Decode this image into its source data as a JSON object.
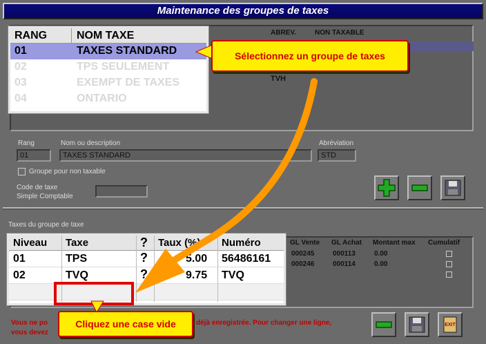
{
  "window": {
    "title": "Maintenance des groupes de taxes"
  },
  "tax_groups_grid": {
    "headers": [
      "ABREV.",
      "NON TAXABLE"
    ],
    "visible_abrev_row3": "TVH"
  },
  "zoom_groups": {
    "columns": [
      "RANG",
      "NOM TAXE"
    ],
    "rows": [
      {
        "rang": "01",
        "nom": "TAXES STANDARD",
        "selected": true
      },
      {
        "rang": "02",
        "nom": "TPS SEULEMENT"
      },
      {
        "rang": "03",
        "nom": "EXEMPT DE TAXES"
      },
      {
        "rang": "04",
        "nom": "ONTARIO"
      }
    ]
  },
  "callout_select": "Sélectionnez un groupe de taxes",
  "form": {
    "rang_label": "Rang",
    "rang_value": "01",
    "nom_label": "Nom ou description",
    "nom_value": "TAXES STANDARD",
    "abrev_label": "Abréviation",
    "abrev_value": "STD",
    "non_taxable_label": "Groupe pour non taxable",
    "code_taxe_label_1": "Code de taxe",
    "code_taxe_label_2": "Simple Comptable"
  },
  "taxes_section_label": "Taxes du groupe de taxe",
  "taxes_grid": {
    "headers": [
      "GL Vente",
      "GL Achat",
      "Montant max",
      "Cumulatif"
    ],
    "rows": [
      {
        "gl_vente": "000245",
        "gl_achat": "000113",
        "montant": "0.00"
      },
      {
        "gl_vente": "000246",
        "gl_achat": "000114",
        "montant": "0.00"
      }
    ]
  },
  "zoom_taxes": {
    "columns": [
      "Niveau",
      "Taxe",
      "?",
      "Taux (%)",
      "Numéro"
    ],
    "rows": [
      {
        "niveau": "01",
        "taxe": "TPS",
        "q": "?",
        "taux": "5.00",
        "numero": "56486161"
      },
      {
        "niveau": "02",
        "taxe": "TVQ",
        "q": "?",
        "taux": "9.75",
        "numero": "TVQ"
      }
    ]
  },
  "callout_empty": "Cliquez une case vide",
  "warning": {
    "line1_a": "Vous ne po",
    "line1_b": "déjà enregistrée. Pour changer une ligne,",
    "line2_a": "vous devez"
  },
  "colors": {
    "accent": "#ffee00",
    "callout_text": "#d00000",
    "arrow": "#ff9900"
  }
}
